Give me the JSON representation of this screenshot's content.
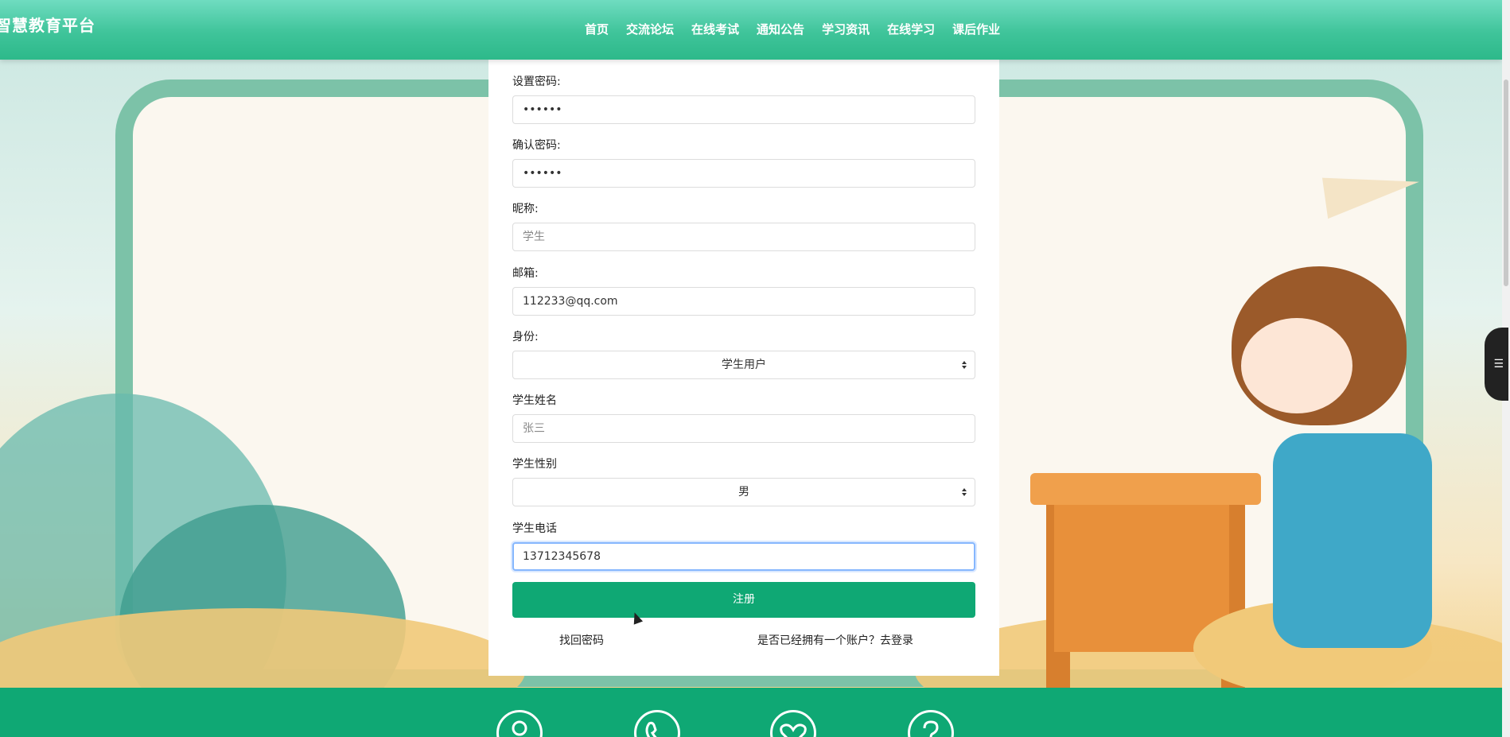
{
  "header": {
    "brand": "智慧教育平台",
    "nav": [
      "首页",
      "交流论坛",
      "在线考试",
      "通知公告",
      "学习资讯",
      "在线学习",
      "课后作业"
    ]
  },
  "form": {
    "password": {
      "label": "设置密码:",
      "value": "••••••"
    },
    "confirm_password": {
      "label": "确认密码:",
      "value": "••••••"
    },
    "nickname": {
      "label": "昵称:",
      "value": "学生"
    },
    "email": {
      "label": "邮箱:",
      "value": "112233@qq.com"
    },
    "identity": {
      "label": "身份:",
      "value": "学生用户"
    },
    "student_name": {
      "label": "学生姓名",
      "placeholder": "张三"
    },
    "student_gender": {
      "label": "学生性别",
      "value": "男"
    },
    "student_phone": {
      "label": "学生电话",
      "value": "13712345678"
    },
    "submit": "注册",
    "forgot_password": "找回密码",
    "has_account": "是否已经拥有一个账户？去登录"
  },
  "footer": {
    "icons": [
      "user-icon",
      "phone-icon",
      "heart-icon",
      "question-icon"
    ]
  },
  "side_tab": {
    "icon": "menu-icon"
  },
  "colors": {
    "header": "#3fc49a",
    "primary": "#0fa874",
    "focus_border": "#86b7fe"
  }
}
